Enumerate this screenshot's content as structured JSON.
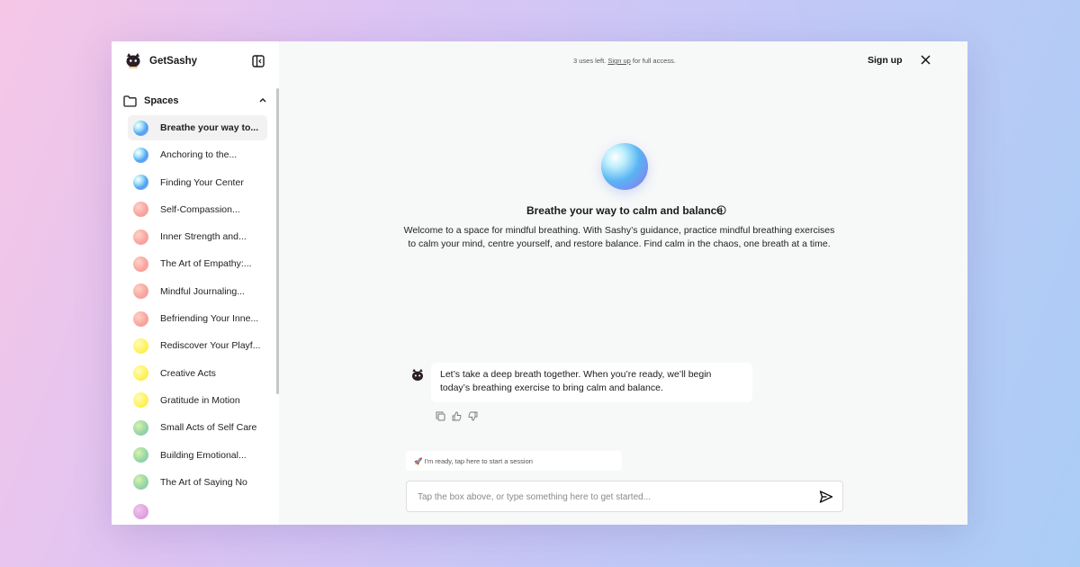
{
  "app": {
    "name": "GetSashy"
  },
  "sidebar": {
    "section_label": "Spaces",
    "items": [
      {
        "label": "Breathe your way to...",
        "orb": "blue",
        "active": true
      },
      {
        "label": "Anchoring to the...",
        "orb": "blue"
      },
      {
        "label": "Finding Your Center",
        "orb": "blue"
      },
      {
        "label": "Self-Compassion...",
        "orb": "pink"
      },
      {
        "label": "Inner Strength and...",
        "orb": "pink"
      },
      {
        "label": "The Art of Empathy:...",
        "orb": "pink"
      },
      {
        "label": "Mindful Journaling...",
        "orb": "pink"
      },
      {
        "label": "Befriending Your Inne...",
        "orb": "pink"
      },
      {
        "label": "Rediscover Your Playf...",
        "orb": "yellow"
      },
      {
        "label": "Creative Acts",
        "orb": "yellow"
      },
      {
        "label": "Gratitude in Motion",
        "orb": "yellow"
      },
      {
        "label": "Small Acts of Self Care",
        "orb": "green"
      },
      {
        "label": "Building Emotional...",
        "orb": "green"
      },
      {
        "label": "The Art of Saying No",
        "orb": "green"
      }
    ]
  },
  "header": {
    "notice_prefix": "3 uses left.",
    "notice_link": "Sign up",
    "notice_suffix": "for full access.",
    "signup_label": "Sign up"
  },
  "hero": {
    "title": "Breathe your way to calm and balance",
    "description": "Welcome to a space for mindful breathing. With Sashy’s guidance, practice mindful breathing exercises to calm your mind, centre yourself, and restore balance. Find calm in the chaos, one breath at a time."
  },
  "chat": {
    "messages": [
      {
        "role": "bot",
        "text": "Let’s take a deep breath together. When you’re ready, we’ll begin today’s breathing exercise to bring calm and balance."
      }
    ]
  },
  "composer": {
    "suggestion": "🚀 I'm ready, tap here to start a session",
    "placeholder": "Tap the box above, or type something here to get started...",
    "value": ""
  },
  "icons": {
    "collapse": "sidebar-toggle-icon",
    "folder": "folder-icon",
    "chevron": "chevron-up-icon",
    "close": "close-icon",
    "info": "info-icon",
    "copy": "copy-icon",
    "like": "thumbs-up-icon",
    "dislike": "thumbs-down-icon",
    "send": "send-icon"
  }
}
